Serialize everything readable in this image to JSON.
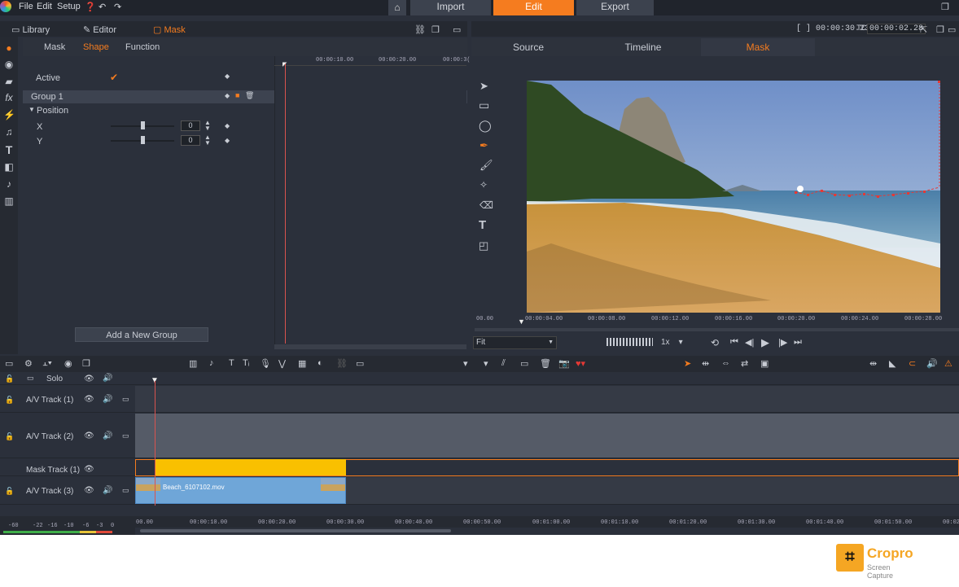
{
  "menu": {
    "file": "File",
    "edit": "Edit",
    "setup": "Setup"
  },
  "modes": {
    "import": "Import",
    "edit": "Edit",
    "export": "Export"
  },
  "left_tabs": {
    "library": "Library",
    "editor": "Editor",
    "mask": "Mask"
  },
  "sub_tabs": {
    "mask": "Mask",
    "shape": "Shape",
    "function": "Function"
  },
  "props": {
    "active": "Active",
    "group": "Group 1",
    "position": "Position",
    "x_label": "X",
    "x_value": "0",
    "y_label": "Y",
    "y_value": "0",
    "add_group": "Add a New Group"
  },
  "mini_ruler": [
    "00:00:10.00",
    "00:00:20.00",
    "00:00:3("
  ],
  "right_tabs": {
    "source": "Source",
    "timeline": "Timeline",
    "mask": "Mask"
  },
  "timecode": {
    "duration": "00:00:30.23",
    "tc_label": "TC",
    "current": "00:00:02.28"
  },
  "player": {
    "ruler": [
      "00.00",
      "00:00:04.00",
      "00:00:08.00",
      "00:00:12.00",
      "00:00:16.00",
      "00:00:20.00",
      "00:00:24.00",
      "00:00:28.00"
    ],
    "fit": "Fit",
    "speed": "1x"
  },
  "tracks": {
    "solo": "Solo",
    "av1": "A/V Track (1)",
    "av2": "A/V Track (2)",
    "mask": "Mask Track (1)",
    "av3": "A/V Track (3)",
    "clip_name": "Beach_6107102.mov"
  },
  "bottom_ruler": [
    "00.00",
    "00:00:10.00",
    "00:00:20.00",
    "00:00:30.00",
    "00:00:40.00",
    "00:00:50.00",
    "00:01:00.00",
    "00:01:10.00",
    "00:01:20.00",
    "00:01:30.00",
    "00:01:40.00",
    "00:01:50.00",
    "00:02"
  ],
  "meter_labels": [
    "-60",
    "-22",
    "-16",
    "-10",
    "-6",
    "-3",
    "0"
  ],
  "watermark": {
    "title": "Cropro",
    "subtitle": "Screen Capture"
  },
  "colors": {
    "accent": "#f57c1f",
    "clip_mask": "#f9c000",
    "clip_video": "#6fa6d8",
    "mask_point": "#e53935"
  }
}
